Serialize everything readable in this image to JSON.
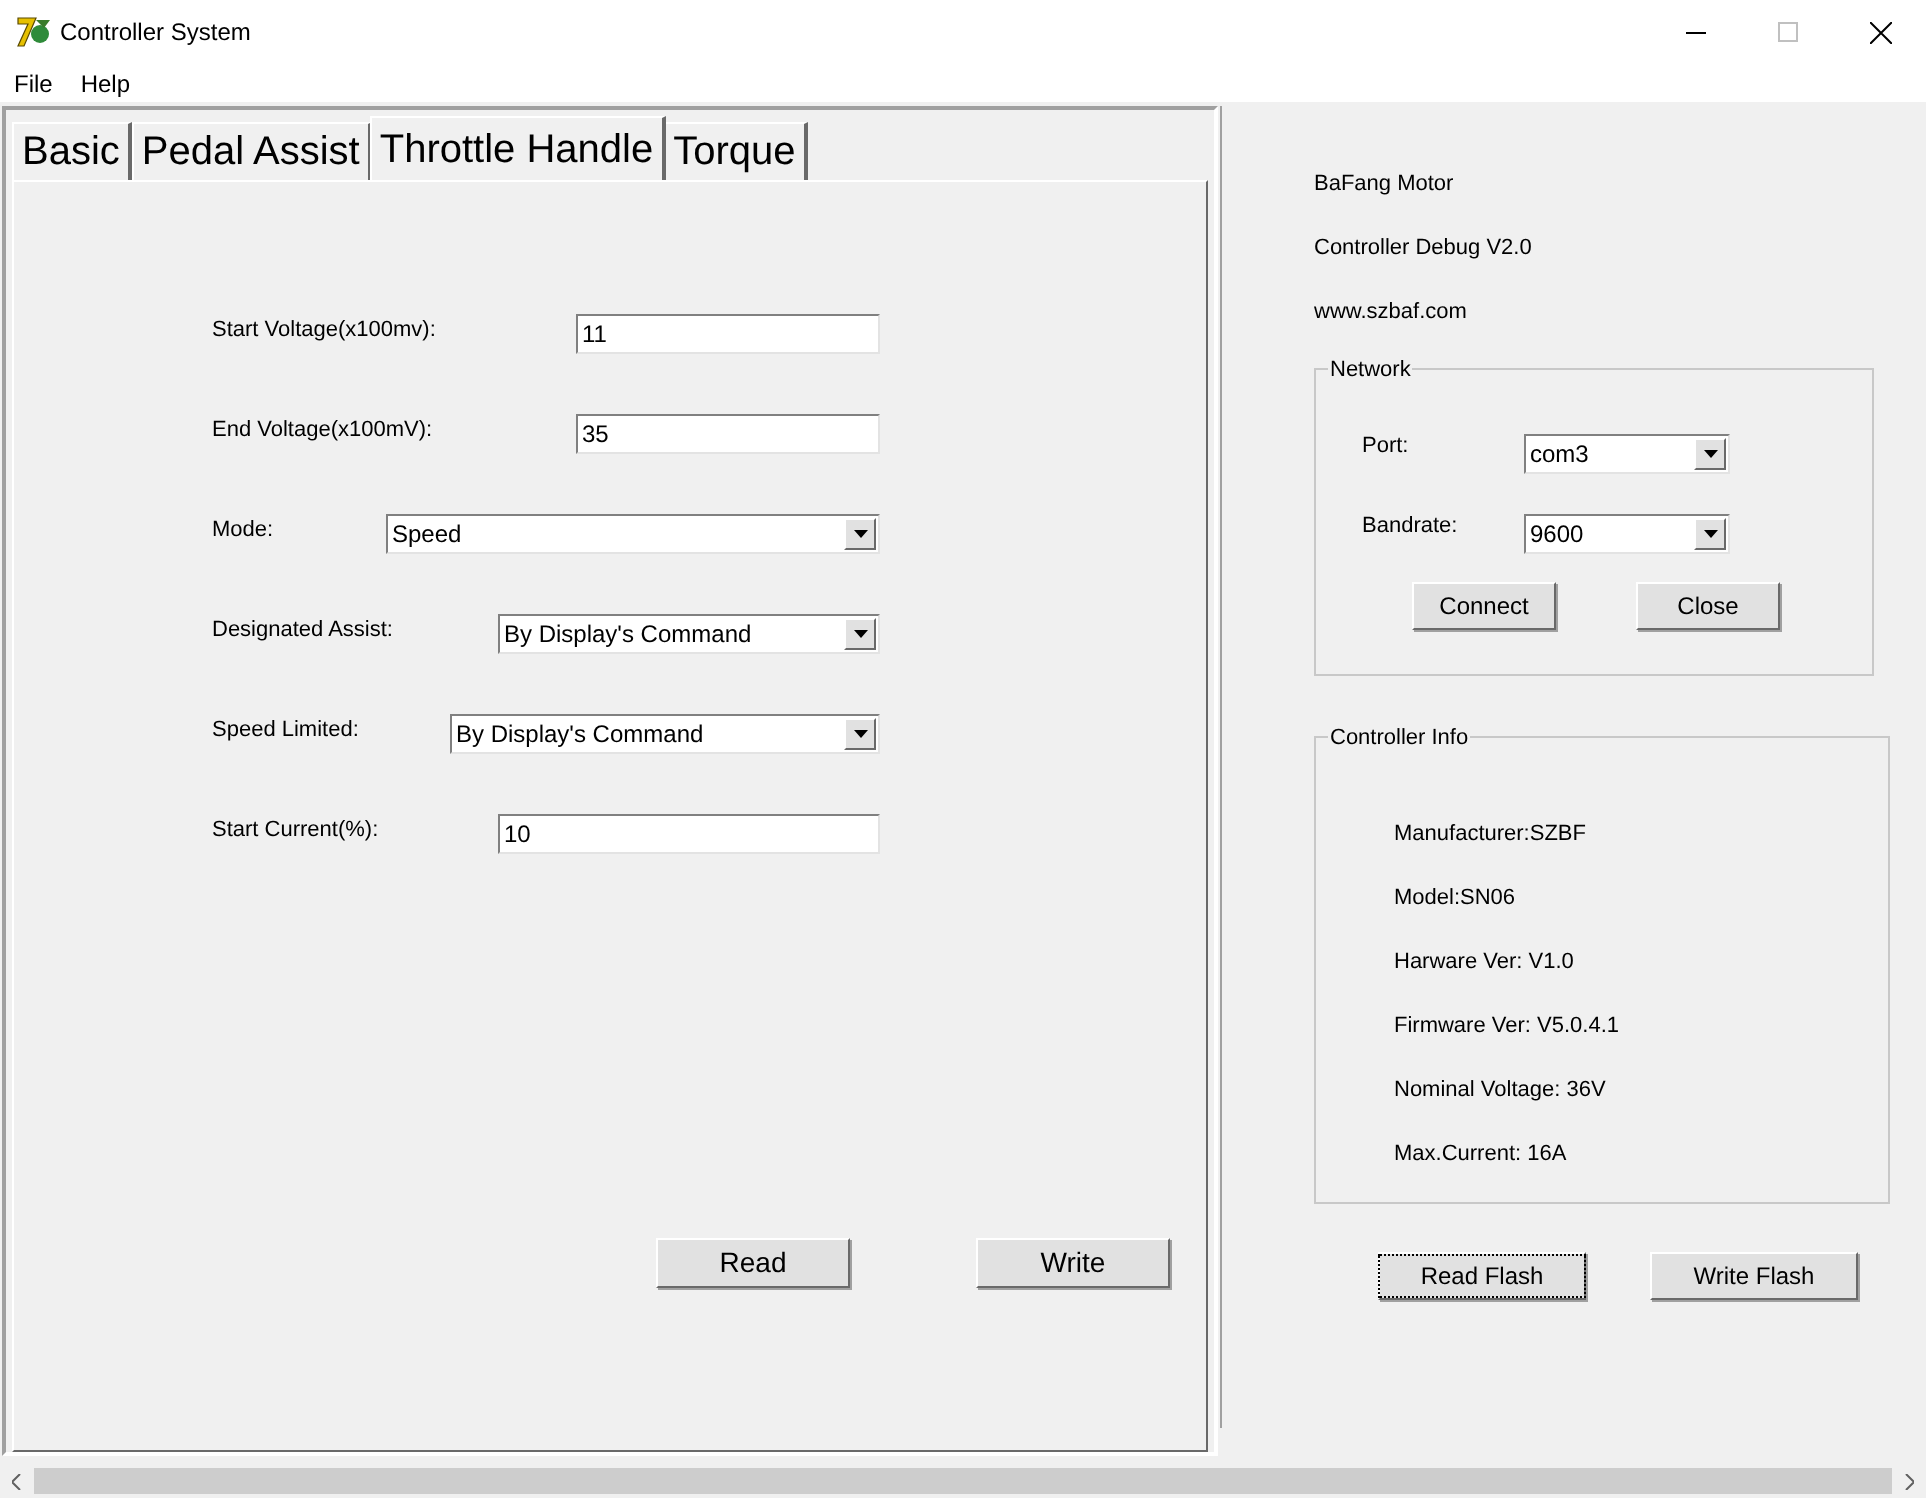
{
  "window": {
    "title": "Controller System"
  },
  "menu": [
    "File",
    "Help"
  ],
  "tabs": [
    {
      "label": "Basic",
      "selected": false
    },
    {
      "label": "Pedal Assist",
      "selected": false
    },
    {
      "label": "Throttle Handle",
      "selected": true
    },
    {
      "label": "Torque",
      "selected": false
    }
  ],
  "form": [
    {
      "label": "Start Voltage(x100mv):",
      "kind": "text",
      "value": "11"
    },
    {
      "label": "End Voltage(x100mV):",
      "kind": "text",
      "value": "35"
    },
    {
      "label": "Mode:",
      "kind": "dropdown",
      "value": "Speed"
    },
    {
      "label": "Designated Assist:",
      "kind": "dropdown",
      "value": "By Display's Command"
    },
    {
      "label": "Speed Limited:",
      "kind": "dropdown",
      "value": "By Display's Command"
    },
    {
      "label": "Start Current(%):",
      "kind": "text",
      "value": "10"
    }
  ],
  "form_buttons": [
    {
      "label": "Read",
      "focused": false
    },
    {
      "label": "Write",
      "focused": false
    }
  ],
  "about": [
    "BaFang Motor",
    "Controller Debug V2.0",
    "www.szbaf.com"
  ],
  "network": {
    "title": "Network",
    "fields": [
      {
        "label": "Port:",
        "value": "com3"
      },
      {
        "label": "Bandrate:",
        "value": "9600"
      }
    ],
    "buttons": [
      {
        "label": "Connect",
        "focused": false
      },
      {
        "label": "Close",
        "focused": false
      }
    ]
  },
  "controller_info": {
    "title": "Controller Info",
    "lines": [
      "Manufacturer:SZBF",
      "Model:SN06",
      "Harware Ver: V1.0",
      "Firmware Ver: V5.0.4.1",
      "Nominal Voltage: 36V",
      "Max.Current: 16A"
    ]
  },
  "flash_buttons": [
    {
      "label": "Read Flash",
      "focused": true
    },
    {
      "label": "Write Flash",
      "focused": false
    }
  ]
}
